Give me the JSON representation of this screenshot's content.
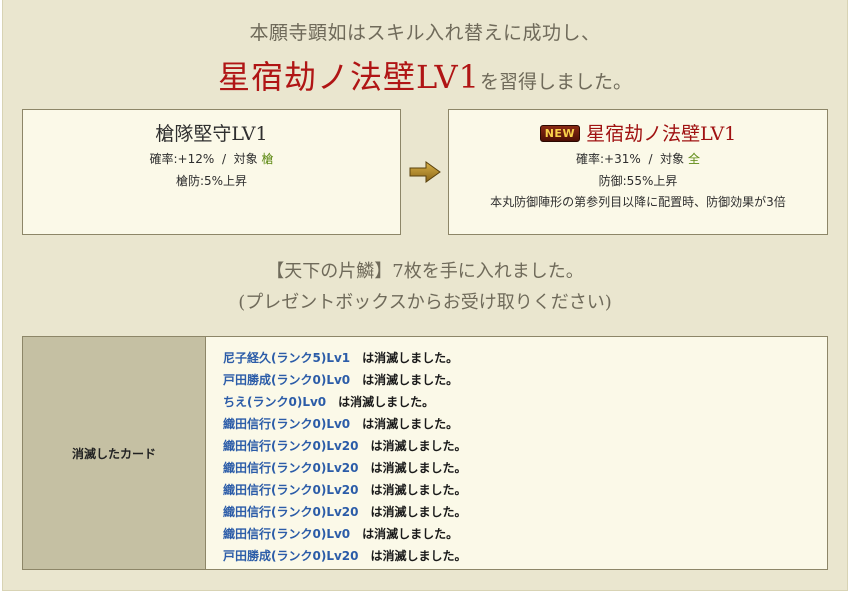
{
  "result": {
    "line1": "本願寺顕如はスキル入れ替えに成功し、",
    "skill_name": "星宿劫ノ法壁LV1",
    "line2_suffix": "を習得しました。"
  },
  "old_skill": {
    "title": "槍隊堅守LV1",
    "rate": "確率:+12%",
    "sep": "/",
    "target_label": "対象",
    "target": "槍",
    "effect": "槍防:5%上昇"
  },
  "new_skill": {
    "badge": "NEW",
    "title": "星宿劫ノ法壁LV1",
    "rate": "確率:+31%",
    "sep": "/",
    "target_label": "対象",
    "target": "全",
    "effect": "防御:55%上昇",
    "description": "本丸防御陣形の第参列目以降に配置時、防御効果が3倍"
  },
  "reward": {
    "line1": "【天下の片鱗】7枚を手に入れました。",
    "line2": "(プレゼントボックスからお受け取りください)"
  },
  "lost_cards": {
    "header": "消滅したカード",
    "suffix": "は消滅しました。",
    "items": [
      {
        "name": "尼子経久(ランク5)Lv1"
      },
      {
        "name": "戸田勝成(ランク0)Lv0"
      },
      {
        "name": "ちえ(ランク0)Lv0"
      },
      {
        "name": "織田信行(ランク0)Lv0"
      },
      {
        "name": "織田信行(ランク0)Lv20"
      },
      {
        "name": "織田信行(ランク0)Lv20"
      },
      {
        "name": "織田信行(ランク0)Lv20"
      },
      {
        "name": "織田信行(ランク0)Lv20"
      },
      {
        "name": "織田信行(ランク0)Lv0"
      },
      {
        "name": "戸田勝成(ランク0)Lv20"
      }
    ]
  },
  "icons": {
    "arrow": "arrow-right-icon"
  },
  "colors": {
    "accent_red": "#b01515",
    "link_blue": "#2b5ca8",
    "target_green": "#5e8a14"
  }
}
